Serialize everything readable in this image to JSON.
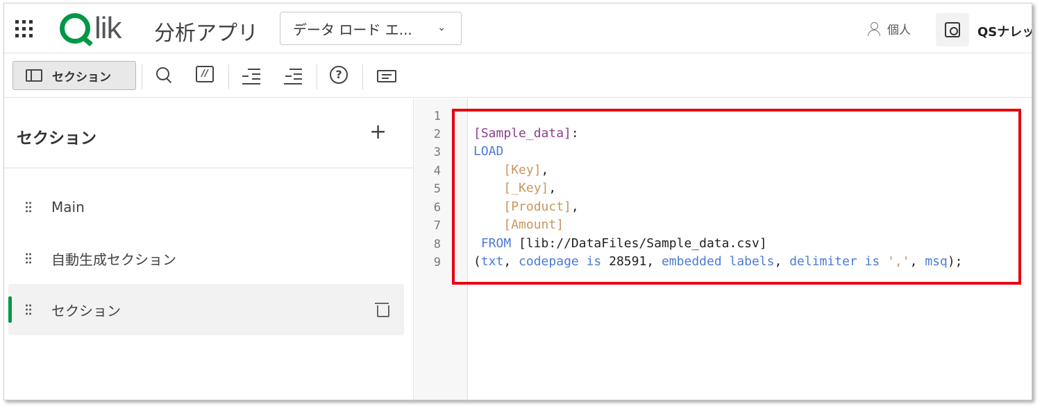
{
  "header": {
    "logo_text": "lik",
    "app_title": "分析アプリ",
    "dropdown_value": "データ ロード エ...",
    "personal_label": "個人",
    "qs_label": "QSナレッ"
  },
  "toolbar": {
    "section_button_label": "セクション"
  },
  "sidebar": {
    "title": "セクション",
    "add_symbol": "+",
    "items": [
      {
        "label": "Main"
      },
      {
        "label": "自動生成セクション"
      },
      {
        "label": "セクション"
      }
    ]
  },
  "editor": {
    "line_numbers": [
      "1",
      "2",
      "3",
      "4",
      "5",
      "6",
      "7",
      "8",
      "9"
    ],
    "lines": {
      "l2_table": "[Sample_data]",
      "l2_colon": ":",
      "l3_kw": "LOAD",
      "l4_field": "[Key]",
      "l4_punct": ",",
      "l5_field": "[_Key]",
      "l5_punct": ",",
      "l6_field": "[Product]",
      "l6_punct": ",",
      "l7_field": "[Amount]",
      "l8_kw": "FROM",
      "l8_path": "[lib://DataFiles/Sample_data.csv]",
      "l9_open": "(",
      "l9_txt": "txt",
      "l9_c1": ", ",
      "l9_codepage": "codepage is",
      "l9_num": " 28591, ",
      "l9_embedded": "embedded labels",
      "l9_c2": ", ",
      "l9_delim": "delimiter is",
      "l9_sp": " ",
      "l9_str": "','",
      "l9_c3": ", ",
      "l9_msq": "msq",
      "l9_close": ");"
    }
  },
  "colors": {
    "brand_green": "#009845",
    "highlight_red": "#e60012",
    "keyword_blue": "#4b7bd6",
    "field_orange": "#c8955c",
    "table_purple": "#8b3f8b"
  }
}
